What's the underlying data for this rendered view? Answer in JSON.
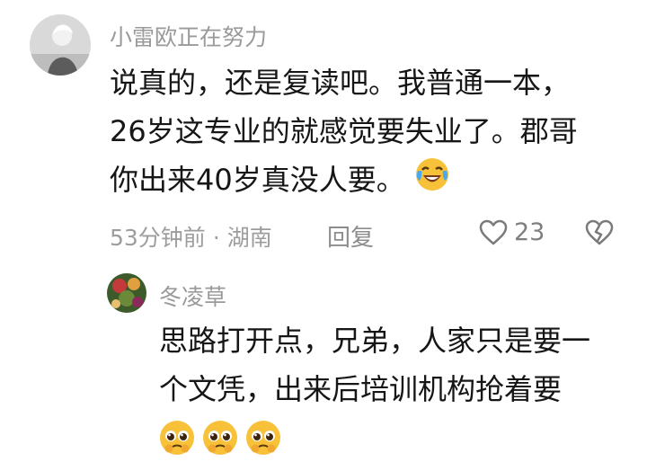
{
  "comment": {
    "user_name": "小雷欧正在努力",
    "lines": [
      "说真的，还是复读吧。我普通一本，",
      "26岁这专业的就感觉要失业了。郡哥",
      "你出来40岁真没人要。"
    ],
    "time": "53分钟前",
    "separator": "·",
    "location": "湖南",
    "reply_label": "回复",
    "like_count": "23",
    "icons": {
      "inline_emoji": "laughing-crying-emoji-icon",
      "like": "heart-icon",
      "dislike": "broken-heart-icon"
    }
  },
  "reply": {
    "user_name": "冬凌草",
    "lines": [
      "思路打开点，兄弟，人家只是要一",
      "个文凭，出来后培训机构抢着要"
    ],
    "emojis": [
      "pleading-face-emoji-icon",
      "pleading-face-emoji-icon",
      "pleading-face-emoji-icon"
    ]
  },
  "colors": {
    "name": "#9a9a9a",
    "text": "#161616",
    "meta": "#9d9d9d",
    "emoji": "#f7c23a"
  }
}
